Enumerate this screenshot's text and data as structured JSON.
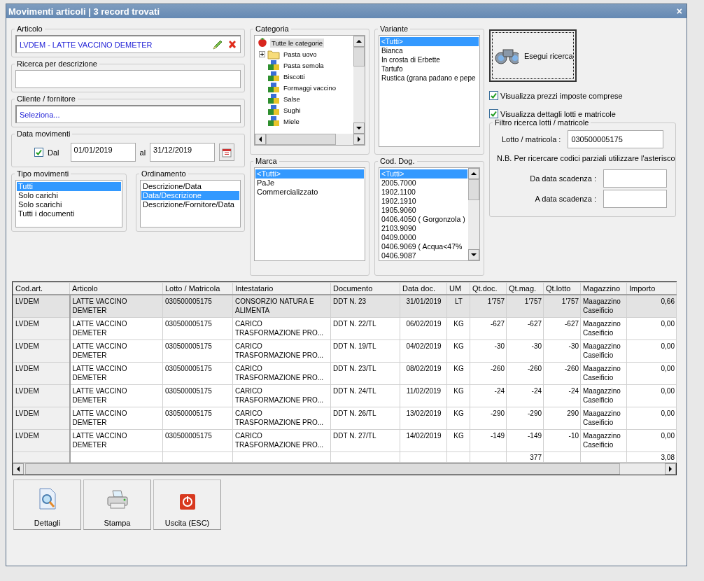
{
  "window": {
    "title": "Movimenti articoli | 3 record trovati",
    "close": "×"
  },
  "articolo": {
    "label": "Articolo",
    "value": "LVDEM - LATTE VACCINO DEMETER"
  },
  "ricerca": {
    "label": "Ricerca per descrizione"
  },
  "cliente": {
    "label": "Cliente / fornitore",
    "value": "Seleziona..."
  },
  "data_movimenti": {
    "label": "Data movimenti",
    "dal_label": "Dal",
    "dal_checked": true,
    "from": "01/01/2019",
    "to_label": "al",
    "to": "31/12/2019"
  },
  "tipo_movimenti": {
    "label": "Tipo movimenti",
    "items": [
      {
        "label": "Tutti",
        "selected": true
      },
      {
        "label": "Solo carichi",
        "selected": false
      },
      {
        "label": "Solo scarichi",
        "selected": false
      },
      {
        "label": "Tutti i documenti",
        "selected": false
      }
    ]
  },
  "ordinamento": {
    "label": "Ordinamento",
    "items": [
      {
        "label": "Descrizione/Data",
        "selected": false
      },
      {
        "label": "Data/Descrizione",
        "selected": true
      },
      {
        "label": "Descrizione/Fornitore/Data",
        "selected": false
      }
    ]
  },
  "categoria": {
    "label": "Categoria",
    "tree": [
      {
        "label": "Tutte le categorie",
        "kind": "root",
        "selected": true,
        "children": [
          {
            "label": "Pasta uovo",
            "kind": "folder",
            "expanded": false,
            "selected": false
          },
          {
            "label": "Pasta semola",
            "kind": "category",
            "selected": false
          },
          {
            "label": "Biscotti",
            "kind": "category",
            "selected": false
          },
          {
            "label": "Formaggi vaccino",
            "kind": "category",
            "selected": false
          },
          {
            "label": "Salse",
            "kind": "category",
            "selected": false
          },
          {
            "label": "Sughi",
            "kind": "category",
            "selected": false
          },
          {
            "label": "Miele",
            "kind": "category",
            "selected": false
          }
        ]
      }
    ]
  },
  "variante": {
    "label": "Variante",
    "items": [
      {
        "label": "<Tutti>",
        "selected": true
      },
      {
        "label": "Bianca",
        "selected": false
      },
      {
        "label": "In crosta di Erbette",
        "selected": false
      },
      {
        "label": "Tartufo",
        "selected": false
      },
      {
        "label": "Rustica (grana padano e pepe",
        "selected": false
      }
    ]
  },
  "marca": {
    "label": "Marca",
    "items": [
      {
        "label": "<Tutti>",
        "selected": true
      },
      {
        "label": "PaJe",
        "selected": false
      },
      {
        "label": "Commercializzato",
        "selected": false
      }
    ]
  },
  "cod_dog": {
    "label": "Cod. Dog.",
    "items": [
      {
        "label": "<Tutti>",
        "selected": true
      },
      {
        "label": "2005.7000",
        "selected": false
      },
      {
        "label": "1902.1100",
        "selected": false
      },
      {
        "label": "1902.1910",
        "selected": false
      },
      {
        "label": "1905.9060",
        "selected": false
      },
      {
        "label": "0406.4050 ( Gorgonzola )",
        "selected": false
      },
      {
        "label": "2103.9090",
        "selected": false
      },
      {
        "label": "0409.0000",
        "selected": false
      },
      {
        "label": "0406.9069 ( Acqua<47%",
        "selected": false
      },
      {
        "label": "0406.9087",
        "selected": false
      }
    ]
  },
  "search_button": {
    "label": "Esegui ricerca"
  },
  "options": [
    {
      "label": "Visualizza prezzi imposte comprese",
      "checked": true
    },
    {
      "label": "Visualizza dettagli lotti e matricole",
      "checked": true
    }
  ],
  "filtro": {
    "label": "Filtro ricerca lotti / matricole",
    "lotto_label": "Lotto / matricola :",
    "lotto_value": "030500005175",
    "note": "N.B. Per ricercare codici parziali utilizzare l'asterisco",
    "da_label": "Da data scadenza :",
    "a_label": "A data scadenza :"
  },
  "table": {
    "columns": [
      {
        "label": "Cod.art.",
        "kind": "code"
      },
      {
        "label": "Articolo",
        "kind": "text"
      },
      {
        "label": "Lotto / Matricola",
        "kind": "text"
      },
      {
        "label": "Intestatario",
        "kind": "text"
      },
      {
        "label": "Documento",
        "kind": "text"
      },
      {
        "label": "Data doc.",
        "kind": "date"
      },
      {
        "label": "UM",
        "kind": "unit"
      },
      {
        "label": "Qt.doc.",
        "kind": "number"
      },
      {
        "label": "Qt.mag.",
        "kind": "number",
        "total": "377"
      },
      {
        "label": "Qt.lotto",
        "kind": "number"
      },
      {
        "label": "Magazzino",
        "kind": "text"
      },
      {
        "label": "Importo",
        "kind": "number",
        "total": "3,08"
      }
    ],
    "rows": [
      {
        "selected": true,
        "cells": [
          "LVDEM",
          "LATTE VACCINO DEMETER",
          "030500005175",
          "CONSORZIO NATURA E ALIMENTA",
          "DDT N. 23",
          "31/01/2019",
          "LT",
          "1'757",
          "1'757",
          "1'757",
          "Maagazzino Caseificio",
          "0,66"
        ]
      },
      {
        "selected": false,
        "cells": [
          "LVDEM",
          "LATTE VACCINO DEMETER",
          "030500005175",
          "CARICO TRASFORMAZIONE PRO...",
          "DDT N. 22/TL",
          "06/02/2019",
          "KG",
          "-627",
          "-627",
          "-627",
          "Maagazzino Caseificio",
          "0,00"
        ]
      },
      {
        "selected": false,
        "cells": [
          "LVDEM",
          "LATTE VACCINO DEMETER",
          "030500005175",
          "CARICO TRASFORMAZIONE PRO...",
          "DDT N. 19/TL",
          "04/02/2019",
          "KG",
          "-30",
          "-30",
          "-30",
          "Maagazzino Caseificio",
          "0,00"
        ]
      },
      {
        "selected": false,
        "cells": [
          "LVDEM",
          "LATTE VACCINO DEMETER",
          "030500005175",
          "CARICO TRASFORMAZIONE PRO...",
          "DDT N. 23/TL",
          "08/02/2019",
          "KG",
          "-260",
          "-260",
          "-260",
          "Maagazzino Caseificio",
          "0,00"
        ]
      },
      {
        "selected": false,
        "cells": [
          "LVDEM",
          "LATTE VACCINO DEMETER",
          "030500005175",
          "CARICO TRASFORMAZIONE PRO...",
          "DDT N. 24/TL",
          "11/02/2019",
          "KG",
          "-24",
          "-24",
          "-24",
          "Maagazzino Caseificio",
          "0,00"
        ]
      },
      {
        "selected": false,
        "cells": [
          "LVDEM",
          "LATTE VACCINO DEMETER",
          "030500005175",
          "CARICO TRASFORMAZIONE PRO...",
          "DDT N. 26/TL",
          "13/02/2019",
          "KG",
          "-290",
          "-290",
          "290",
          "Maagazzino Caseificio",
          "0,00"
        ]
      },
      {
        "selected": false,
        "cells": [
          "LVDEM",
          "LATTE VACCINO DEMETER",
          "030500005175",
          "CARICO TRASFORMAZIONE PRO...",
          "DDT N. 27/TL",
          "14/02/2019",
          "KG",
          "-149",
          "-149",
          "-10",
          "Maagazzino Caseificio",
          "0,00"
        ]
      }
    ]
  },
  "buttons": [
    {
      "label": "Dettagli",
      "kind": "details"
    },
    {
      "label": "Stampa",
      "kind": "print"
    },
    {
      "label": "Uscita (ESC)",
      "kind": "exit"
    }
  ]
}
